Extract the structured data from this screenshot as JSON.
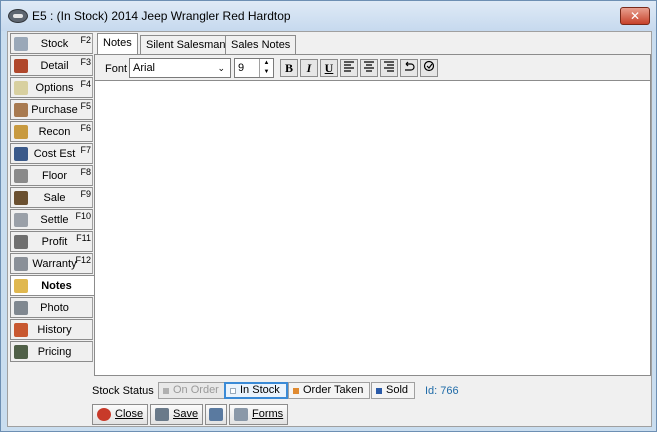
{
  "window": {
    "title": "E5 : (In Stock) 2014 Jeep Wrangler  Red Hardtop",
    "close_label": "✕"
  },
  "sidebar": {
    "items": [
      {
        "label": "Stock",
        "key": "F2",
        "icon": "stock-icon",
        "color": "#9aa8b8"
      },
      {
        "label": "Detail",
        "key": "F3",
        "icon": "detail-icon",
        "color": "#b0482c"
      },
      {
        "label": "Options",
        "key": "F4",
        "icon": "options-icon",
        "color": "#d8d0a0"
      },
      {
        "label": "Purchase",
        "key": "F5",
        "icon": "purchase-icon",
        "color": "#a87a50"
      },
      {
        "label": "Recon",
        "key": "F6",
        "icon": "recon-icon",
        "color": "#c89a40"
      },
      {
        "label": "Cost Est",
        "key": "F7",
        "icon": "cost-est-icon",
        "color": "#3b5a8a"
      },
      {
        "label": "Floor",
        "key": "F8",
        "icon": "floor-icon",
        "color": "#8a8a8a"
      },
      {
        "label": "Sale",
        "key": "F9",
        "icon": "sale-icon",
        "color": "#6a5030"
      },
      {
        "label": "Settle",
        "key": "F10",
        "icon": "settle-icon",
        "color": "#9aa0a8"
      },
      {
        "label": "Profit",
        "key": "F11",
        "icon": "profit-icon",
        "color": "#707070"
      },
      {
        "label": "Warranty",
        "key": "F12",
        "icon": "warranty-icon",
        "color": "#8a9098"
      },
      {
        "label": "Notes",
        "key": "",
        "icon": "notes-icon",
        "color": "#e0b850"
      },
      {
        "label": "Photo",
        "key": "",
        "icon": "photo-icon",
        "color": "#808890"
      },
      {
        "label": "History",
        "key": "",
        "icon": "history-icon",
        "color": "#c85830"
      },
      {
        "label": "Pricing",
        "key": "",
        "icon": "pricing-icon",
        "color": "#506048"
      }
    ]
  },
  "tabs": [
    {
      "label": "Notes"
    },
    {
      "label": "Silent Salesman"
    },
    {
      "label": "Sales Notes"
    }
  ],
  "toolbar": {
    "font_label": "Font",
    "font_value": "Arial",
    "size_value": "9",
    "bold": "B",
    "italic": "I",
    "underline": "U"
  },
  "status": {
    "label": "Stock Status",
    "on_order": "On Order",
    "in_stock": "In Stock",
    "order_taken": "Order Taken",
    "sold": "Sold",
    "id_text": "Id: 766",
    "colors": {
      "on_order": "#b0b0b0",
      "in_stock": "#ffffff",
      "order_taken": "#e08a30",
      "sold": "#2a5aa8"
    }
  },
  "actions": {
    "close_label": "Close",
    "save_label": "Save",
    "forms_label": "Forms"
  }
}
